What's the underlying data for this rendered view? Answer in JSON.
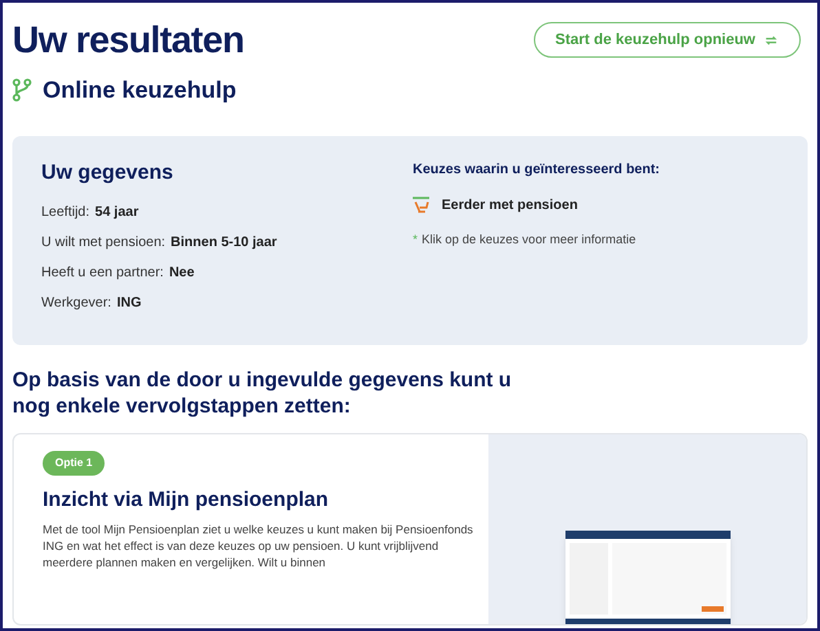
{
  "header": {
    "title": "Uw resultaten",
    "restart_button": "Start de keuzehulp opnieuw"
  },
  "subtitle": "Online keuzehulp",
  "details": {
    "title": "Uw gegevens",
    "fields": [
      {
        "label": "Leeftijd:",
        "value": "54 jaar"
      },
      {
        "label": "U wilt met pensioen:",
        "value": "Binnen 5-10 jaar"
      },
      {
        "label": "Heeft u een partner:",
        "value": "Nee"
      },
      {
        "label": "Werkgever:",
        "value": "ING"
      }
    ],
    "choices_title": "Keuzes waarin u geïnteresseerd bent:",
    "choices": [
      "Eerder met pensioen"
    ],
    "note_mark": "*",
    "note": "Klik op de keuzes voor meer informatie"
  },
  "next_steps_title": "Op basis van de door u ingevulde gegevens kunt u nog enkele vervolgstappen zetten:",
  "options": [
    {
      "badge": "Optie 1",
      "title": "Inzicht via Mijn pensioenplan",
      "text": "Met de tool Mijn Pensioenplan ziet u welke keuzes u kunt maken bij Pensioenfonds ING en wat het effect is van deze keuzes op uw pensioen. U kunt vrijblijvend meerdere plannen maken en vergelijken. Wilt u binnen"
    }
  ]
}
